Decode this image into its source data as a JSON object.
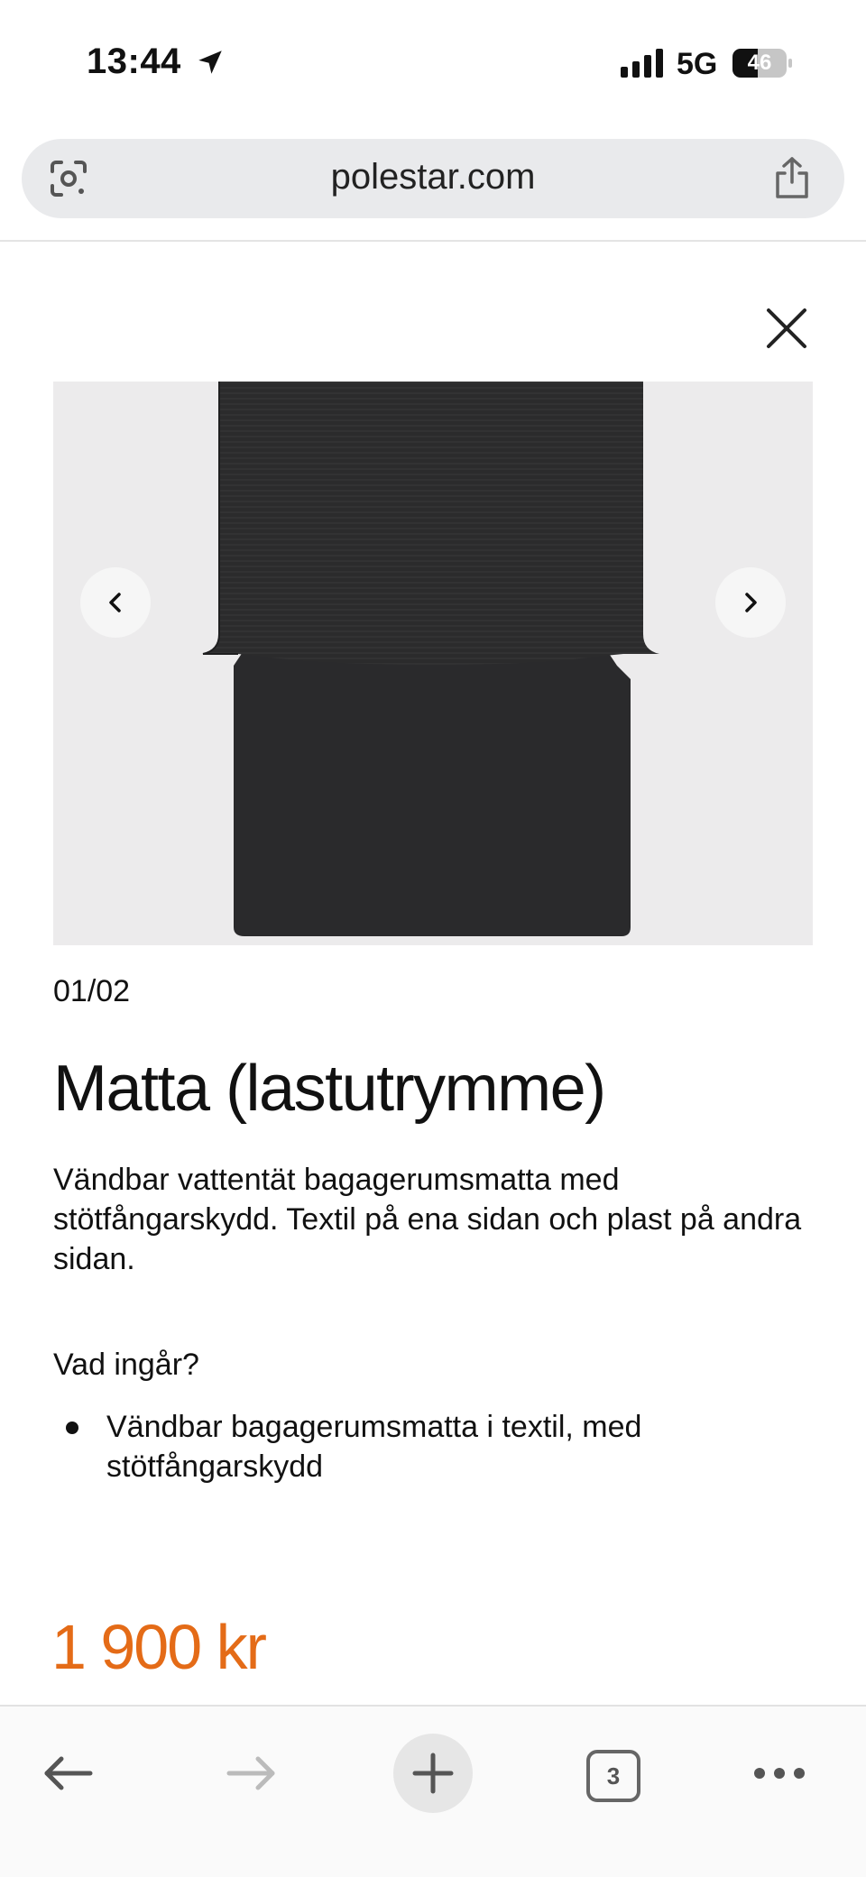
{
  "status_bar": {
    "time": "13:44",
    "network": "5G",
    "battery_level": "46",
    "battery_fraction": 0.46
  },
  "browser": {
    "url": "polestar.com",
    "tabs_count": "3"
  },
  "product": {
    "image_counter": "01/02",
    "title": "Matta (lastutrymme)",
    "description": "Vändbar vattentät bagagerumsmatta med stötfångarskydd. Textil på ena sidan och plast på andra sidan.",
    "included_heading": "Vad ingår?",
    "included_items": [
      "Vändbar bagagerumsmatta i textil, med stötfångarskydd"
    ],
    "price": "1 900 kr"
  },
  "icons": {
    "location": "location-arrow-icon",
    "lens": "google-lens-icon",
    "share": "share-icon",
    "close": "close-icon",
    "prev": "chevron-left-icon",
    "next": "chevron-right-icon",
    "back": "arrow-left-icon",
    "forward": "arrow-right-icon",
    "new_tab": "plus-icon",
    "more": "more-dots-icon"
  },
  "colors": {
    "price": "#e46b17",
    "url_bar": "#e9eaec",
    "gallery_bg": "#ecebec"
  }
}
